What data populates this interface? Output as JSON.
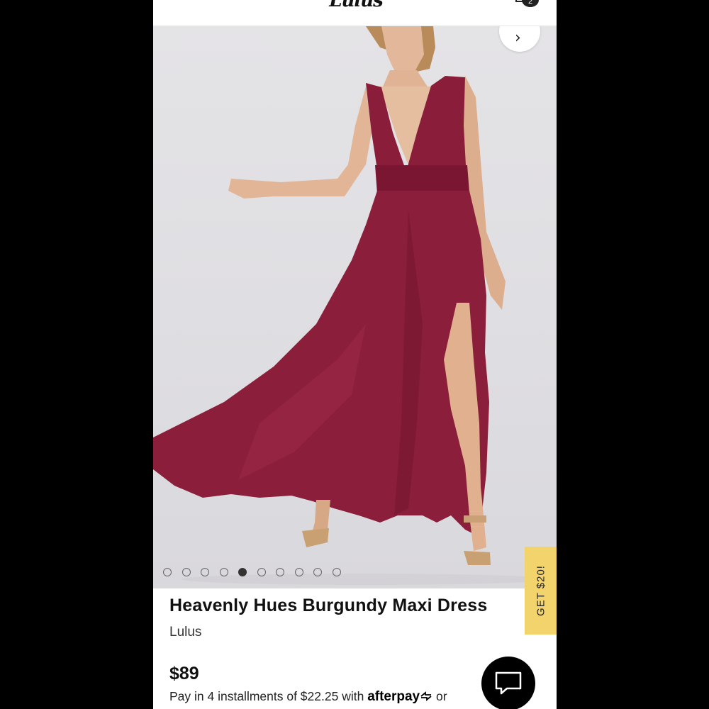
{
  "header": {
    "logo_text": "Lulus",
    "bag_count": "2"
  },
  "hero": {
    "image_alt": "Model wearing burgundy maxi dress with side slit",
    "dress_color": "#8b1e3a",
    "next_arrow_glyph": "›",
    "carousel": {
      "total": 10,
      "active_index": 4
    }
  },
  "promo": {
    "label": "GET $20!",
    "color": "#f3d36b"
  },
  "product": {
    "title": "Heavenly Hues Burgundy Maxi Dress",
    "brand": "Lulus",
    "price": "$89",
    "installments_prefix": "Pay in 4 installments of $22.25 with ",
    "installments_provider": "afterpay",
    "installments_suffix": " or"
  },
  "chat": {
    "icon": "chat-bubble-icon"
  }
}
